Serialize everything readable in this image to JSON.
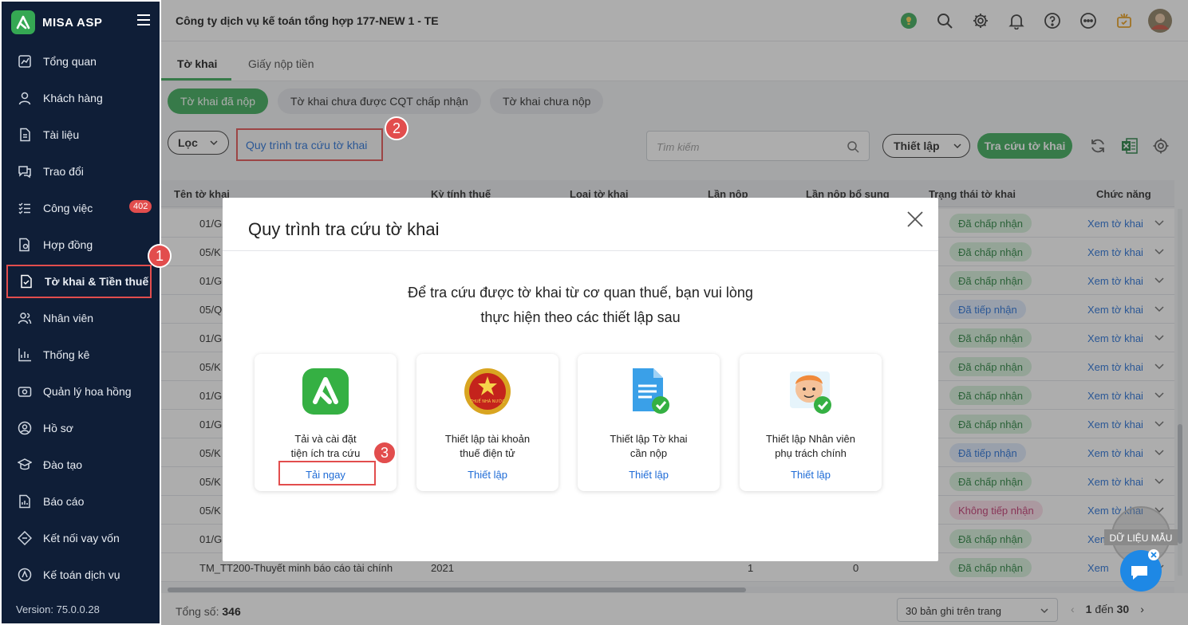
{
  "app": {
    "brand": "MISA ASP",
    "version": "Version: 75.0.0.28"
  },
  "sidebar": {
    "items": [
      {
        "label": "Tổng quan",
        "icon": "dashboard-icon"
      },
      {
        "label": "Khách hàng",
        "icon": "user-icon"
      },
      {
        "label": "Tài liệu",
        "icon": "document-icon"
      },
      {
        "label": "Trao đổi",
        "icon": "chat-icon"
      },
      {
        "label": "Công việc",
        "icon": "task-list-icon",
        "badge": "402"
      },
      {
        "label": "Hợp đồng",
        "icon": "contract-icon"
      },
      {
        "label": "Tờ khai & Tiền thuế",
        "icon": "tax-file-icon",
        "active": true
      },
      {
        "label": "Nhân viên",
        "icon": "staff-icon"
      },
      {
        "label": "Thống kê",
        "icon": "stats-icon"
      },
      {
        "label": "Quản lý hoa hồng",
        "icon": "commission-icon"
      },
      {
        "label": "Hồ sơ",
        "icon": "profile-icon"
      },
      {
        "label": "Đào tạo",
        "icon": "training-icon"
      },
      {
        "label": "Báo cáo",
        "icon": "report-icon"
      },
      {
        "label": "Kết nối vay vốn",
        "icon": "loan-icon"
      },
      {
        "label": "Kế toán dịch vụ",
        "icon": "accounting-icon"
      }
    ]
  },
  "header": {
    "company": "Công ty dịch vụ kế toán tổng hợp 177-NEW 1 - TE"
  },
  "tabs": [
    {
      "label": "Tờ khai"
    },
    {
      "label": "Giấy nộp tiền"
    }
  ],
  "pills": [
    {
      "label": "Tờ khai đã nộp"
    },
    {
      "label": "Tờ khai chưa được CQT chấp nhận"
    },
    {
      "label": "Tờ khai chưa nộp"
    }
  ],
  "toolbar": {
    "filter": "Lọc",
    "process_link": "Quy trình tra cứu tờ khai",
    "search_placeholder": "Tìm kiếm",
    "setup": "Thiết lập",
    "lookup": "Tra cứu tờ khai"
  },
  "table": {
    "headers": [
      "Tên tờ khai",
      "Kỳ tính thuế",
      "Loại tờ khai",
      "Lần nộp",
      "Lần nộp bổ sung",
      "Trạng thái tờ khai",
      "Chức năng"
    ],
    "rows": [
      {
        "name": "01/G",
        "status": "Đã chấp nhận",
        "kind": "ok",
        "action": "Xem tờ khai"
      },
      {
        "name": "05/K",
        "status": "Đã chấp nhận",
        "kind": "ok",
        "action": "Xem tờ khai"
      },
      {
        "name": "01/G",
        "status": "Đã chấp nhận",
        "kind": "ok",
        "action": "Xem tờ khai"
      },
      {
        "name": "05/Q",
        "status": "Đã tiếp nhận",
        "kind": "recv",
        "action": "Xem tờ khai"
      },
      {
        "name": "01/G",
        "status": "Đã chấp nhận",
        "kind": "ok",
        "action": "Xem tờ khai"
      },
      {
        "name": "05/K",
        "status": "Đã chấp nhận",
        "kind": "ok",
        "action": "Xem tờ khai"
      },
      {
        "name": "01/G",
        "status": "Đã chấp nhận",
        "kind": "ok",
        "action": "Xem tờ khai"
      },
      {
        "name": "01/G",
        "status": "Đã chấp nhận",
        "kind": "ok",
        "action": "Xem tờ khai"
      },
      {
        "name": "05/K",
        "status": "Đã tiếp nhận",
        "kind": "recv",
        "action": "Xem tờ khai"
      },
      {
        "name": "05/K",
        "status": "Đã chấp nhận",
        "kind": "ok",
        "action": "Xem tờ khai"
      },
      {
        "name": "05/K",
        "status": "Không tiếp nhận",
        "kind": "no",
        "action": "Xem tờ khai"
      },
      {
        "name": "01/G",
        "status": "Đã chấp nhận",
        "kind": "ok",
        "action": "Xem"
      },
      {
        "name": "TM_TT200-Thuyết minh báo cáo tài chính",
        "period": "2021",
        "submit": "1",
        "extra": "0",
        "status": "Đã chấp nhận",
        "kind": "ok",
        "action": "Xem"
      }
    ]
  },
  "footer": {
    "total_label": "Tổng số:",
    "total_value": "346",
    "per_page": "30 bản ghi trên trang",
    "range_from": "1",
    "range_sep": "đến",
    "range_to": "30"
  },
  "modal": {
    "title": "Quy trình tra cứu tờ khai",
    "message_line1": "Để tra cứu được tờ khai từ cơ quan thuế, bạn vui lòng",
    "message_line2": "thực hiện theo các thiết lập sau",
    "cards": [
      {
        "line1": "Tải và cài đặt",
        "line2": "tiện ích tra cứu",
        "action": "Tải ngay",
        "icon": "misa-app-icon"
      },
      {
        "line1": "Thiết lập tài khoản",
        "line2": "thuế điện tử",
        "action": "Thiết lập",
        "icon": "tax-emblem-icon",
        "emblem_text": "THUẾ NHÀ NƯỚC"
      },
      {
        "line1": "Thiết lập Tờ khai",
        "line2": "cần nộp",
        "action": "Thiết lập",
        "icon": "document-check-icon"
      },
      {
        "line1": "Thiết lập Nhân viên",
        "line2": "phụ trách chính",
        "action": "Thiết lập",
        "icon": "person-check-icon"
      }
    ]
  },
  "callouts": [
    "1",
    "2",
    "3"
  ],
  "watermark": "DỮ LIỆU MẪU",
  "colors": {
    "accent": "#35a853",
    "sidebar": "#0f1e37",
    "link": "#1e6bd6",
    "callout": "#e24d4d"
  }
}
